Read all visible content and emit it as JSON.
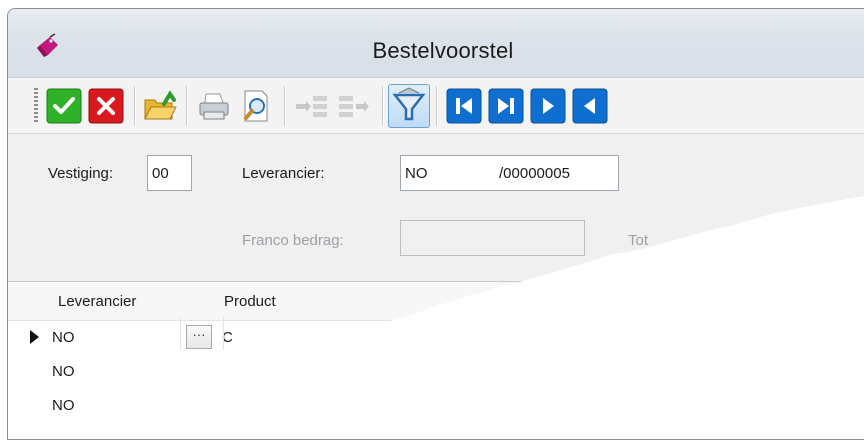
{
  "window": {
    "title": "Bestelvoorstel"
  },
  "icons": {
    "app": "tag-icon",
    "toolbar": [
      "check-icon",
      "close-icon",
      "folder-open-icon",
      "printer-icon",
      "print-preview-icon",
      "move-right-icon",
      "move-left-icon",
      "filter-icon",
      "first-record-icon",
      "last-record-icon",
      "next-record-icon",
      "previous-record-icon"
    ]
  },
  "form": {
    "vestiging_label": "Vestiging:",
    "vestiging_value": "00",
    "leverancier_label": "Leverancier:",
    "leverancier_code": "NO",
    "leverancier_number": "/00000005",
    "franco_label": "Franco bedrag:",
    "franco_value": "",
    "totaal_partial": "Tot"
  },
  "grid": {
    "columns": [
      "Leverancier",
      "Product"
    ],
    "rows": [
      {
        "leverancier": "NO",
        "product": "C",
        "current": true,
        "ellipsis": "···"
      },
      {
        "leverancier": "NO",
        "product": "",
        "current": false
      },
      {
        "leverancier": "NO",
        "product": "",
        "current": false
      }
    ]
  },
  "colors": {
    "accept_green": "#2fb12a",
    "cancel_red": "#d8191f",
    "nav_blue": "#0f6fd0",
    "title_bar": "#dce3ea"
  }
}
